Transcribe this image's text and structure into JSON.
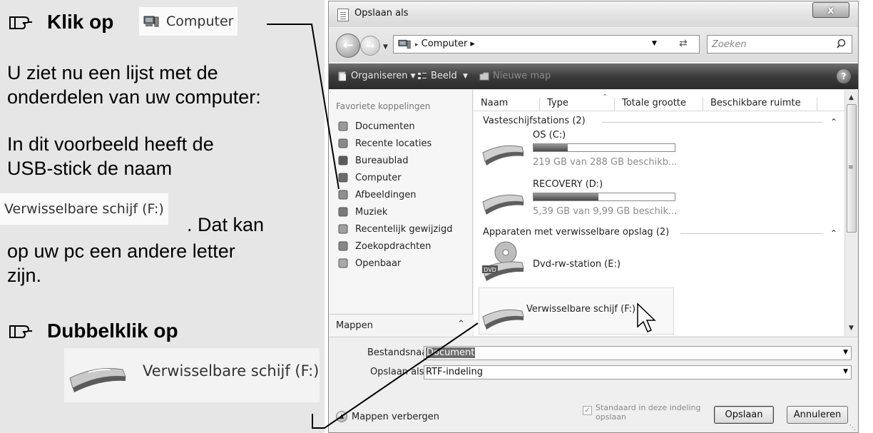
{
  "instructions": {
    "step1_prefix": "Klik op",
    "step1_target": "Computer",
    "paragraph1_line1": "U ziet nu een lijst met de",
    "paragraph1_line2": "onderdelen van uw computer:",
    "paragraph2_line1": "In dit voorbeeld heeft de",
    "paragraph2_line2": "USB-stick de naam",
    "paragraph2_chip": "Verwisselbare schijf (F:)",
    "paragraph2_after": ". Dat kan",
    "paragraph2_line4": "op uw pc een andere letter",
    "paragraph2_line5": "zijn.",
    "step2_text": "Dubbelklik op",
    "step2_target": "Verwisselbare schijf (F:)"
  },
  "dialog": {
    "title": "Opslaan als",
    "close_label": "x",
    "address_path": "Computer ▸",
    "address_sep": "▸",
    "search_placeholder": "Zoeken",
    "toolbar": {
      "organize": "Organiseren",
      "view": "Beeld",
      "new_folder": "Nieuwe map",
      "help": "?"
    },
    "nav": {
      "favorites_header": "Favoriete koppelingen",
      "items": [
        {
          "label": "Documenten",
          "icon": "documents-icon"
        },
        {
          "label": "Recente locaties",
          "icon": "recent-places-icon"
        },
        {
          "label": "Bureaublad",
          "icon": "desktop-icon"
        },
        {
          "label": "Computer",
          "icon": "computer-icon"
        },
        {
          "label": "Afbeeldingen",
          "icon": "pictures-icon"
        },
        {
          "label": "Muziek",
          "icon": "music-icon"
        },
        {
          "label": "Recentelijk gewijzigd",
          "icon": "recently-changed-icon"
        },
        {
          "label": "Zoekopdrachten",
          "icon": "searches-icon"
        },
        {
          "label": "Openbaar",
          "icon": "public-icon"
        }
      ],
      "folders_label": "Mappen"
    },
    "columns": [
      "Naam",
      "Type",
      "Totale grootte",
      "Beschikbare ruimte"
    ],
    "groups": [
      {
        "label": "Vasteschijfstations (2)",
        "drives": [
          {
            "name": "OS (C:)",
            "info": "219 GB van 288 GB beschikb...",
            "used_fraction": 0.24
          },
          {
            "name": "RECOVERY (D:)",
            "info": "5,39 GB van 9,99 GB beschik...",
            "used_fraction": 0.46
          }
        ]
      },
      {
        "label": "Apparaten met verwisselbare opslag (2)",
        "drives": [
          {
            "name": "Dvd-rw-station (E:)",
            "icon_badge": "DVD"
          },
          {
            "name": "Verwisselbare schijf (F:)"
          }
        ]
      }
    ],
    "file_name_label": "Bestandsnaam:",
    "file_name_value": "Document",
    "save_as_label": "Opslaan als:",
    "save_as_value": "RTF-indeling",
    "hide_folders": "Mappen verbergen",
    "default_format_line1": "Standaard in deze indeling",
    "default_format_line2": "opslaan",
    "save_button": "Opslaan",
    "cancel_button": "Annuleren"
  }
}
